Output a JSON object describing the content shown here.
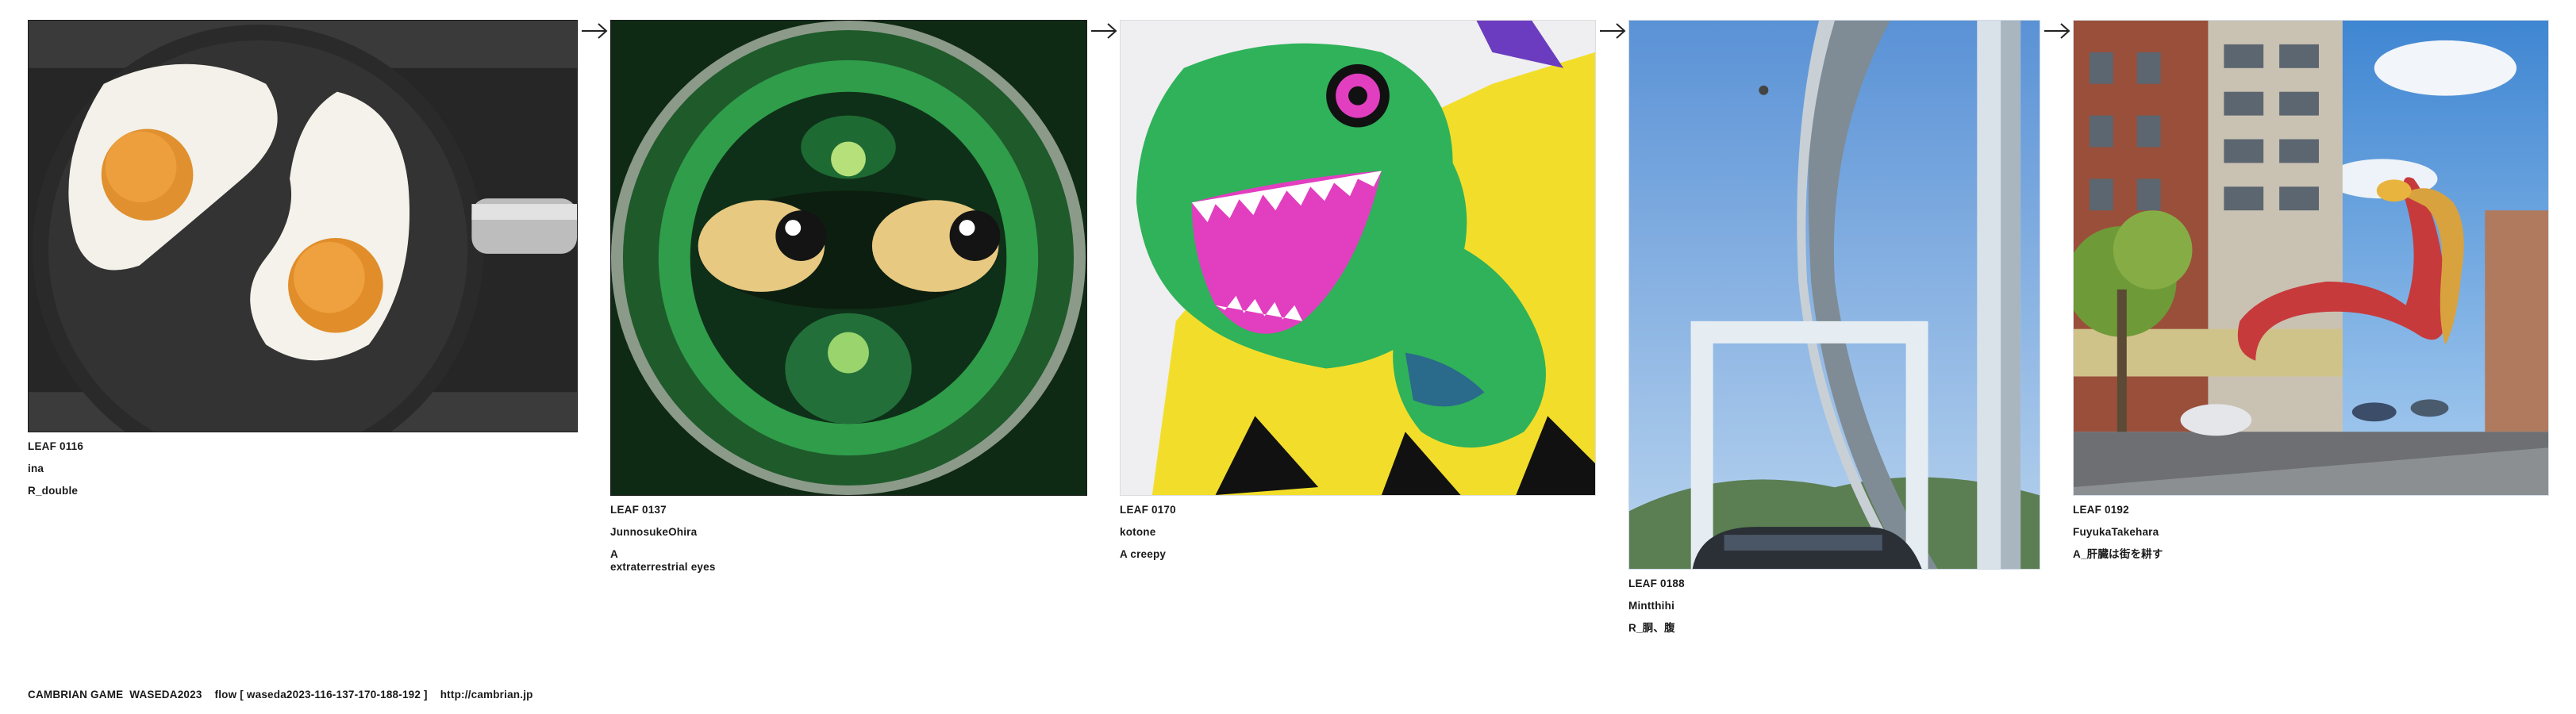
{
  "leaves": [
    {
      "id": "LEAF 0116",
      "author": "ina",
      "title": "R_double"
    },
    {
      "id": "LEAF 0137",
      "author": "JunnosukeOhira",
      "title": "A\nextraterrestrial eyes"
    },
    {
      "id": "LEAF 0170",
      "author": "kotone",
      "title": "A creepy"
    },
    {
      "id": "LEAF 0188",
      "author": "Mintthihi",
      "title": "R_胴、腹"
    },
    {
      "id": "LEAF 0192",
      "author": "FuyukaTakehara",
      "title": "A_肝臓は街を耕す"
    }
  ],
  "footer": {
    "game": "CAMBRIAN GAME  WASEDA2023",
    "flow": "flow [ waseda2023-116-137-170-188-192 ]",
    "url": "http://cambrian.jp"
  },
  "icons": {
    "arrow": "right-arrow-icon"
  }
}
